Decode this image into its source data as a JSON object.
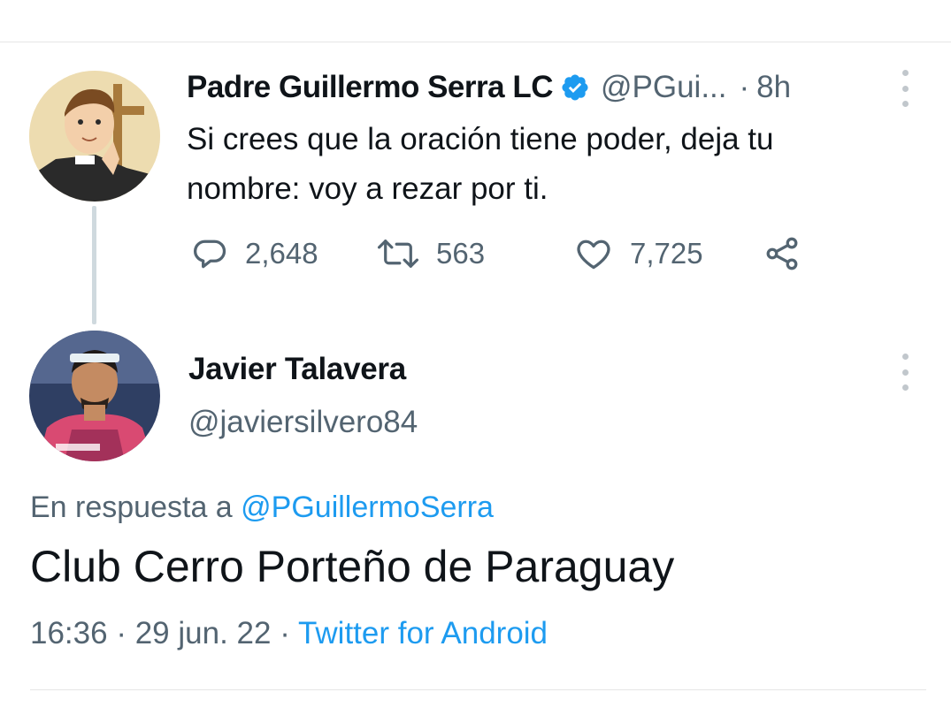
{
  "original_tweet": {
    "author_name": "Padre Guillermo Serra LC",
    "author_handle": "@PGui...",
    "separator": "·",
    "time": "8h",
    "text": "Si crees que la oración tiene poder, deja tu nombre: voy a rezar por ti.",
    "replies": "2,648",
    "retweets": "563",
    "likes": "7,725"
  },
  "reply_tweet": {
    "author_name": "Javier Talavera",
    "author_handle": "@javiersilvero84",
    "reply_prefix": "En respuesta a ",
    "reply_to_handle": "@PGuillermoSerra",
    "text": "Club Cerro Porteño de Paraguay",
    "time": "16:36",
    "separator1": "·",
    "date": "29 jun. 22",
    "separator2": "·",
    "source": "Twitter for Android"
  },
  "colors": {
    "accent": "#1d9bf0",
    "text_primary": "#0f1419",
    "text_secondary": "#536471",
    "thread_line": "#cfd9de"
  },
  "icons": {
    "verified": "verified-badge-icon",
    "more": "more-vertical-icon",
    "reply": "reply-bubble-icon",
    "retweet": "retweet-icon",
    "like": "heart-icon",
    "share": "share-icon"
  }
}
